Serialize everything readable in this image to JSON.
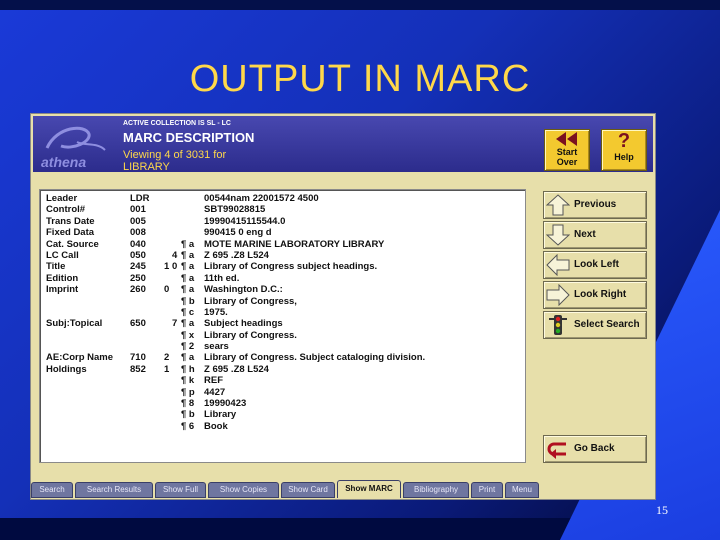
{
  "slide": {
    "title": "OUTPUT IN MARC",
    "number": "15"
  },
  "app": {
    "logo_text": "athena",
    "active_collection": "ACTIVE COLLECTION IS SL - LC",
    "screen_title": "MARC DESCRIPTION",
    "viewing_line1": "Viewing 4 of 3031 for",
    "viewing_line2": "LIBRARY"
  },
  "top_buttons": {
    "start_over": [
      "Start",
      "Over"
    ],
    "help": "Help"
  },
  "marc_rows": [
    {
      "label": "Leader",
      "tag": "LDR",
      "ind1": "",
      "ind2": "",
      "sub": "",
      "value": "00544nam  22001572  4500"
    },
    {
      "label": "Control#",
      "tag": "001",
      "ind1": "",
      "ind2": "",
      "sub": "",
      "value": "SBT99028815"
    },
    {
      "label": "Trans Date",
      "tag": "005",
      "ind1": "",
      "ind2": "",
      "sub": "",
      "value": "19990415115544.0"
    },
    {
      "label": "Fixed Data",
      "tag": "008",
      "ind1": "",
      "ind2": "",
      "sub": "",
      "value": "990415                    0 eng d"
    },
    {
      "label": "Cat. Source",
      "tag": "040",
      "ind1": "",
      "ind2": "",
      "sub": "¶ a",
      "value": "MOTE MARINE LABORATORY LIBRARY"
    },
    {
      "label": "LC Call",
      "tag": "050",
      "ind1": "",
      "ind2": "4",
      "sub": "¶ a",
      "value": "Z 695 .Z8 L524"
    },
    {
      "label": "Title",
      "tag": "245",
      "ind1": "1",
      "ind2": "0",
      "sub": "¶ a",
      "value": "Library of Congress subject headings."
    },
    {
      "label": "Edition",
      "tag": "250",
      "ind1": "",
      "ind2": "",
      "sub": "¶ a",
      "value": "11th ed."
    },
    {
      "label": "Imprint",
      "tag": "260",
      "ind1": "0",
      "ind2": "",
      "sub": "¶ a",
      "value": "Washington D.C.:"
    },
    {
      "label": "",
      "tag": "",
      "ind1": "",
      "ind2": "",
      "sub": "¶ b",
      "value": "Library of Congress,"
    },
    {
      "label": "",
      "tag": "",
      "ind1": "",
      "ind2": "",
      "sub": "¶ c",
      "value": "1975."
    },
    {
      "label": "Subj:Topical",
      "tag": "650",
      "ind1": "",
      "ind2": "7",
      "sub": "¶ a",
      "value": "Subject headings"
    },
    {
      "label": "",
      "tag": "",
      "ind1": "",
      "ind2": "",
      "sub": "¶ x",
      "value": "Library of Congress."
    },
    {
      "label": "",
      "tag": "",
      "ind1": "",
      "ind2": "",
      "sub": "¶ 2",
      "value": "sears"
    },
    {
      "label": "AE:Corp Name",
      "tag": "710",
      "ind1": "2",
      "ind2": "",
      "sub": "¶ a",
      "value": "Library of Congress.  Subject cataloging division."
    },
    {
      "label": "Holdings",
      "tag": "852",
      "ind1": "1",
      "ind2": "",
      "sub": "¶ h",
      "value": "Z 695 .Z8 L524"
    },
    {
      "label": "",
      "tag": "",
      "ind1": "",
      "ind2": "",
      "sub": "¶ k",
      "value": "REF"
    },
    {
      "label": "",
      "tag": "",
      "ind1": "",
      "ind2": "",
      "sub": "¶ p",
      "value": "4427"
    },
    {
      "label": "",
      "tag": "",
      "ind1": "",
      "ind2": "",
      "sub": "¶ 8",
      "value": "19990423"
    },
    {
      "label": "",
      "tag": "",
      "ind1": "",
      "ind2": "",
      "sub": "¶ b",
      "value": "Library"
    },
    {
      "label": "",
      "tag": "",
      "ind1": "",
      "ind2": "",
      "sub": "¶ 6",
      "value": "Book"
    }
  ],
  "side_buttons": {
    "previous": "Previous",
    "next": "Next",
    "look_left": "Look Left",
    "look_right": "Look Right",
    "select_search": "Select Search",
    "go_back": "Go Back"
  },
  "tabs": [
    {
      "label": "Search",
      "active": false
    },
    {
      "label": "Search Results",
      "active": false
    },
    {
      "label": "Show Full",
      "active": false
    },
    {
      "label": "Show Copies",
      "active": false
    },
    {
      "label": "Show Card",
      "active": false
    },
    {
      "label": "Show MARC",
      "active": true
    },
    {
      "label": "Bibliography",
      "active": false
    },
    {
      "label": "Print",
      "active": false
    },
    {
      "label": "Menu",
      "active": false
    }
  ],
  "colors": {
    "slide_title": "#ffd84a",
    "header_bg": "#3a3aa0",
    "window_bg": "#e7dfaa",
    "tab_bg": "#6f76a0"
  },
  "icons": {
    "start_over": "double-left-arrow-icon",
    "help": "question-mark-icon",
    "previous": "up-arrow-icon",
    "next": "down-arrow-icon",
    "look_left": "left-arrow-icon",
    "look_right": "right-arrow-icon",
    "select_search": "traffic-light-icon",
    "go_back": "u-turn-icon"
  }
}
